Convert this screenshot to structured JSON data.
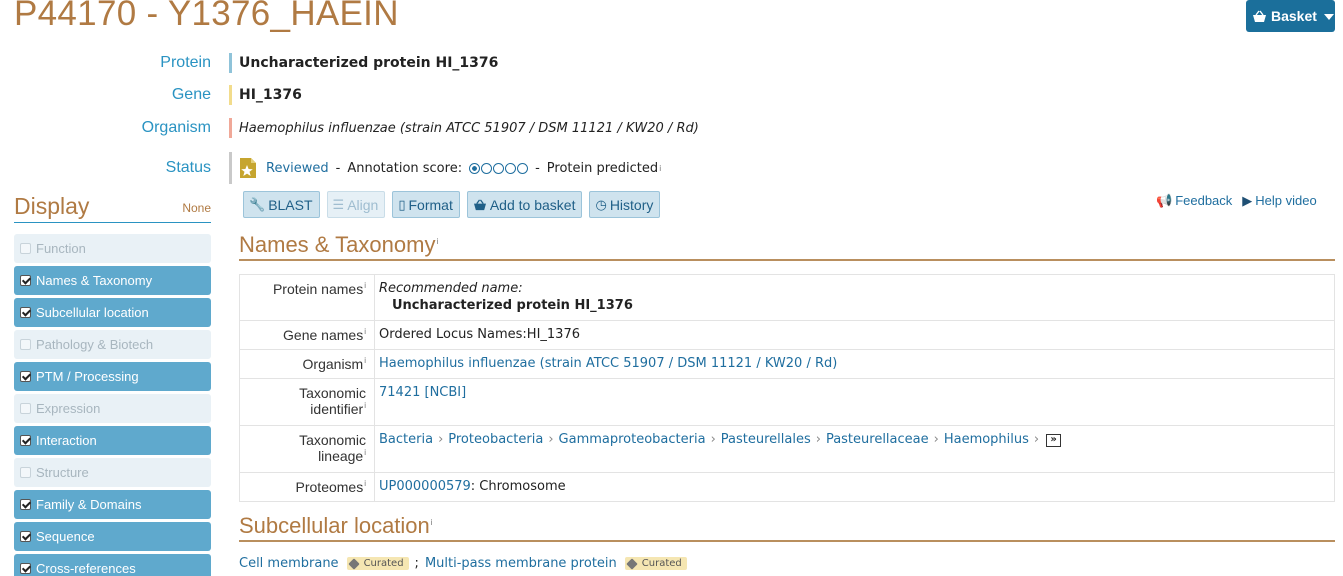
{
  "page": {
    "title": "P44170 - Y1376_HAEIN"
  },
  "basket": {
    "label": "Basket"
  },
  "summary": {
    "protein_label": "Protein",
    "protein_value": "Uncharacterized protein HI_1376",
    "gene_label": "Gene",
    "gene_value": "HI_1376",
    "organism_label": "Organism",
    "organism_value": "Haemophilus influenzae (strain ATCC 51907 / DSM 11121 / KW20 / Rd)",
    "status_label": "Status",
    "status_reviewed": "Reviewed",
    "status_sep1": "-",
    "annotation_label": "Annotation score:",
    "annotation_score": 1,
    "annotation_max": 5,
    "status_sep2": "-",
    "evidence": "Protein predicted",
    "colors": {
      "protein": "#8fc3d9",
      "gene": "#f2dc8c",
      "organism": "#f0a898",
      "status": "#c9c9c9"
    }
  },
  "display": {
    "title": "Display",
    "none_label": "None",
    "items": [
      {
        "label": "Function",
        "checked": false
      },
      {
        "label": "Names & Taxonomy",
        "checked": true
      },
      {
        "label": "Subcellular location",
        "checked": true
      },
      {
        "label": "Pathology & Biotech",
        "checked": false
      },
      {
        "label": "PTM / Processing",
        "checked": true
      },
      {
        "label": "Expression",
        "checked": false
      },
      {
        "label": "Interaction",
        "checked": true
      },
      {
        "label": "Structure",
        "checked": false
      },
      {
        "label": "Family & Domains",
        "checked": true
      },
      {
        "label": "Sequence",
        "checked": true
      },
      {
        "label": "Cross-references",
        "checked": true
      }
    ]
  },
  "toolbar": {
    "blast": "BLAST",
    "align": "Align",
    "format": "Format",
    "add_to_basket": "Add to basket",
    "history": "History",
    "feedback": "Feedback",
    "help_video": "Help video"
  },
  "names_taxonomy": {
    "title": "Names & Taxonomy",
    "protein_names_label": "Protein names",
    "recommended_name_label": "Recommended name:",
    "recommended_name": "Uncharacterized protein HI_1376",
    "gene_names_label": "Gene names",
    "gene_names_value": "Ordered Locus Names:HI_1376",
    "organism_label": "Organism",
    "organism_value": "Haemophilus influenzae (strain ATCC 51907 / DSM 11121 / KW20 / Rd)",
    "taxid_label_1": "Taxonomic",
    "taxid_label_2": "identifier",
    "taxid_value": "71421",
    "taxid_source": "[NCBI]",
    "lineage_label_1": "Taxonomic",
    "lineage_label_2": "lineage",
    "lineage": [
      "Bacteria",
      "Proteobacteria",
      "Gammaproteobacteria",
      "Pasteurellales",
      "Pasteurellaceae",
      "Haemophilus"
    ],
    "proteomes_label": "Proteomes",
    "proteome_id": "UP000000579",
    "proteome_component": ": Chromosome"
  },
  "subcellular": {
    "title": "Subcellular location",
    "location_1": "Cell membrane",
    "badge": "Curated",
    "separator": ";",
    "location_2": "Multi-pass membrane protein"
  }
}
